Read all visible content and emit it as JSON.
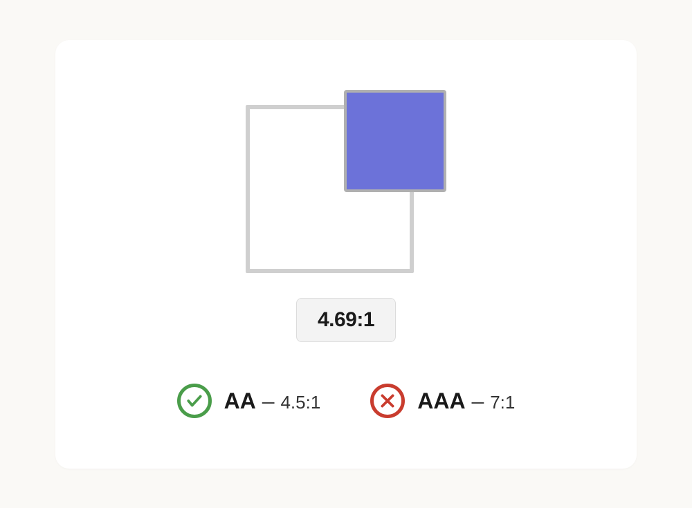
{
  "swatches": {
    "foreground_color": "#6c72d9",
    "background_color": "#ffffff"
  },
  "contrast_ratio": "4.69:1",
  "standards": [
    {
      "level": "AA",
      "required_ratio": "4.5:1",
      "pass": true
    },
    {
      "level": "AAA",
      "required_ratio": "7:1",
      "pass": false
    }
  ]
}
